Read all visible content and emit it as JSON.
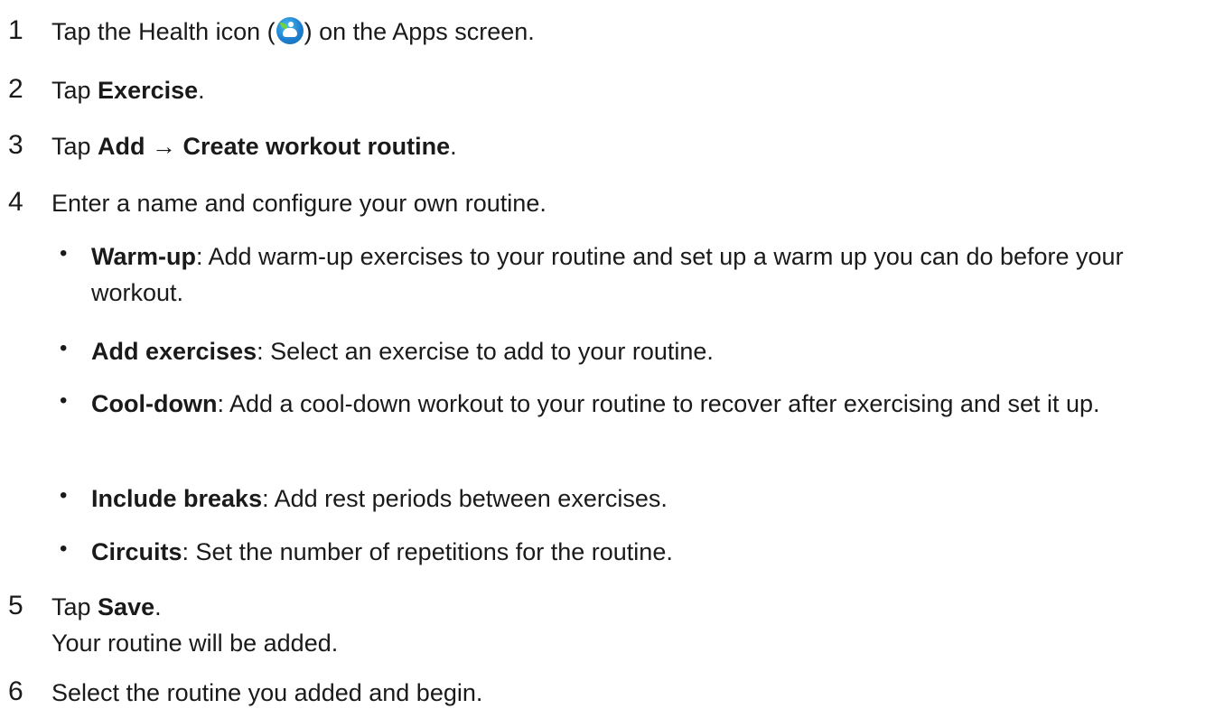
{
  "steps": [
    {
      "number": "1",
      "pre": "Tap the Health icon (",
      "icon": "health-app-icon",
      "post": ") on the Apps screen."
    },
    {
      "number": "2",
      "pre": "Tap ",
      "bold": "Exercise",
      "post": "."
    },
    {
      "number": "3",
      "pre": "Tap ",
      "bold1": "Add",
      "arrow": " → ",
      "bold2": "Create workout routine",
      "post": "."
    },
    {
      "number": "4",
      "text": "Enter a name and configure your own routine.",
      "bullets": [
        {
          "term": "Warm-up",
          "desc": ": Add warm-up exercises to your routine and set up a warm up you can do before your workout."
        },
        {
          "term": "Add exercises",
          "desc": ": Select an exercise to add to your routine."
        },
        {
          "term": "Cool-down",
          "desc": ": Add a cool-down workout to your routine to recover after exercising and set it up."
        },
        {
          "term": "Include breaks",
          "desc": ": Add rest periods between exercises."
        },
        {
          "term": "Circuits",
          "desc": ": Set the number of repetitions for the routine."
        }
      ]
    },
    {
      "number": "5",
      "pre": "Tap ",
      "bold": "Save",
      "post": ".",
      "note": "Your routine will be added."
    },
    {
      "number": "6",
      "text": "Select the routine you added and begin."
    }
  ],
  "bullet_glyph": "•"
}
